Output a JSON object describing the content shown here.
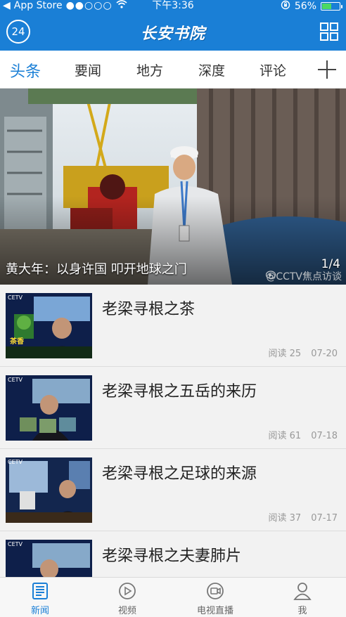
{
  "status": {
    "carrier": "App Store",
    "signal": "●●○○○",
    "time": "下午3:36",
    "battery": "56%",
    "battery_level": 0.56
  },
  "header": {
    "badge": "24",
    "logo": "长安书院"
  },
  "tabs": [
    {
      "label": "头条",
      "active": true
    },
    {
      "label": "要闻",
      "active": false
    },
    {
      "label": "地方",
      "active": false
    },
    {
      "label": "深度",
      "active": false
    },
    {
      "label": "评论",
      "active": false
    }
  ],
  "hero": {
    "caption": "黄大年：以身许国 叩开地球之门",
    "page": "1/4",
    "watermark": "@CCTV焦点访谈"
  },
  "articles": [
    {
      "title": "老梁寻根之茶",
      "reads": "阅读 25",
      "date": "07-20",
      "thumb_logo": "CETV",
      "thumb_text": "茶香"
    },
    {
      "title": "老梁寻根之五岳的来历",
      "reads": "阅读 61",
      "date": "07-18",
      "thumb_logo": "CETV",
      "thumb_text": ""
    },
    {
      "title": "老梁寻根之足球的来源",
      "reads": "阅读 37",
      "date": "07-17",
      "thumb_logo": "CETV",
      "thumb_text": ""
    },
    {
      "title": "老梁寻根之夫妻肺片",
      "reads": "",
      "date": "",
      "thumb_logo": "CETV",
      "thumb_text": ""
    }
  ],
  "tabbar": [
    {
      "label": "新闻",
      "icon": "news-icon",
      "active": true
    },
    {
      "label": "视频",
      "icon": "video-play-icon",
      "active": false
    },
    {
      "label": "电视直播",
      "icon": "tv-camera-icon",
      "active": false
    },
    {
      "label": "我",
      "icon": "user-icon",
      "active": false
    }
  ],
  "colors": {
    "brand": "#1a7fd6",
    "background": "#f2f2f2"
  }
}
